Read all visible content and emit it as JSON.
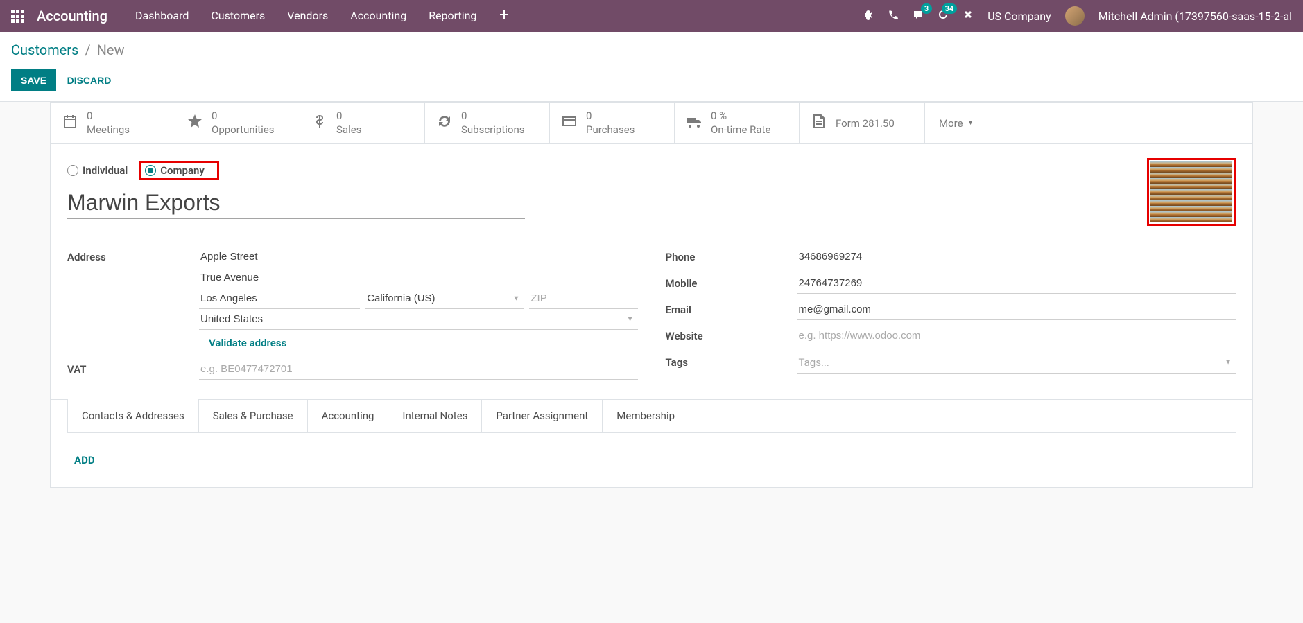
{
  "topnav": {
    "app_title": "Accounting",
    "items": [
      "Dashboard",
      "Customers",
      "Vendors",
      "Accounting",
      "Reporting"
    ],
    "messaging_badge": "3",
    "activity_badge": "34",
    "company": "US Company",
    "user": "Mitchell Admin (17397560-saas-15-2-al"
  },
  "breadcrumb": {
    "root": "Customers",
    "current": "New"
  },
  "actions": {
    "save": "SAVE",
    "discard": "DISCARD"
  },
  "stats": {
    "meetings": {
      "value": "0",
      "label": "Meetings"
    },
    "opportunities": {
      "value": "0",
      "label": "Opportunities"
    },
    "sales": {
      "value": "0",
      "label": "Sales"
    },
    "subscriptions": {
      "value": "0",
      "label": "Subscriptions"
    },
    "purchases": {
      "value": "0",
      "label": "Purchases"
    },
    "ontime": {
      "value": "0 %",
      "label": "On-time Rate"
    },
    "form": "Form 281.50",
    "more": "More"
  },
  "type": {
    "individual": "Individual",
    "company": "Company"
  },
  "name": "Marwin Exports",
  "fields": {
    "address_label": "Address",
    "street": "Apple Street",
    "street2": "True Avenue",
    "city": "Los Angeles",
    "state": "California (US)",
    "zip_placeholder": "ZIP",
    "country": "United States",
    "validate": "Validate address",
    "vat_label": "VAT",
    "vat_placeholder": "e.g. BE0477472701",
    "phone_label": "Phone",
    "phone": "34686969274",
    "mobile_label": "Mobile",
    "mobile": "24764737269",
    "email_label": "Email",
    "email": "me@gmail.com",
    "website_label": "Website",
    "website_placeholder": "e.g. https://www.odoo.com",
    "tags_label": "Tags",
    "tags_placeholder": "Tags..."
  },
  "tabs": [
    "Contacts & Addresses",
    "Sales & Purchase",
    "Accounting",
    "Internal Notes",
    "Partner Assignment",
    "Membership"
  ],
  "add": "ADD"
}
